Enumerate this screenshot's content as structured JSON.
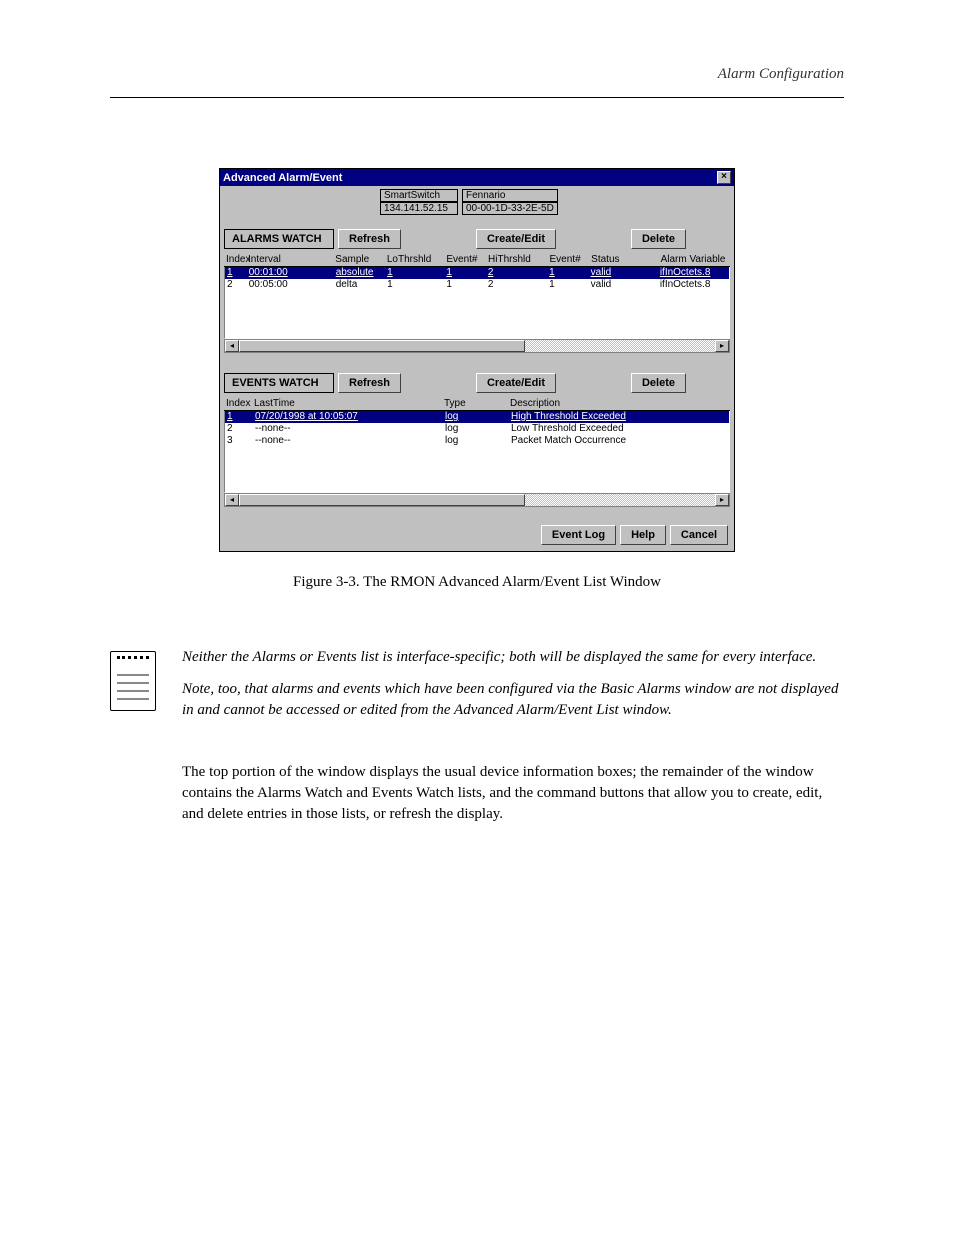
{
  "header": {
    "right": "Alarm Configuration"
  },
  "window": {
    "title": "Advanced Alarm/Event",
    "info": {
      "dev_name": "SmartSwitch",
      "dev_ip": "134.141.52.15",
      "loc_name": "Fennario",
      "mac": "00-00-1D-33-2E-5D"
    }
  },
  "alarms": {
    "label": "ALARMS WATCH",
    "buttons": {
      "refresh": "Refresh",
      "create": "Create/Edit",
      "delete": "Delete"
    },
    "cols": {
      "index": "Index",
      "interval": "Interval",
      "sample": "Sample",
      "lot": "LoThrshld",
      "ev1": "Event#",
      "hit": "HiThrshld",
      "ev2": "Event#",
      "status": "Status",
      "var": "Alarm Variable"
    },
    "rows": [
      {
        "idx": "1",
        "interval": "00:01:00",
        "sample": "absolute",
        "lot": "1",
        "ev1": "1",
        "hit": "2",
        "ev2": "1",
        "status": "valid",
        "var": "ifInOctets.8"
      },
      {
        "idx": "2",
        "interval": "00:05:00",
        "sample": "delta",
        "lot": "1",
        "ev1": "1",
        "hit": "2",
        "ev2": "1",
        "status": "valid",
        "var": "ifInOctets.8"
      }
    ]
  },
  "events": {
    "label": "EVENTS WATCH",
    "buttons": {
      "refresh": "Refresh",
      "create": "Create/Edit",
      "delete": "Delete"
    },
    "cols": {
      "index": "Index",
      "last": "LastTime",
      "type": "Type",
      "desc": "Description"
    },
    "rows": [
      {
        "idx": "1",
        "last": "07/20/1998 at 10:05:07",
        "type": "log",
        "desc": "High Threshold Exceeded"
      },
      {
        "idx": "2",
        "last": "--none--",
        "type": "log",
        "desc": "Low Threshold Exceeded"
      },
      {
        "idx": "3",
        "last": "--none--",
        "type": "log",
        "desc": "Packet Match Occurrence"
      }
    ]
  },
  "bottom": {
    "eventlog": "Event Log",
    "help": "Help",
    "cancel": "Cancel"
  },
  "caption": "Figure 3-3. The RMON Advanced Alarm/Event List Window",
  "note": {
    "p1": "Neither the Alarms or Events list is interface-specific; both will be displayed the same for every interface.",
    "p2": "Note, too, that alarms and events which have been configured via the Basic Alarms window are not displayed in and cannot be accessed or edited from the Advanced Alarm/Event List window."
  },
  "body": "The top portion of the window displays the usual device information boxes; the remainder of the window contains the Alarms Watch and Events Watch lists, and the command buttons that allow you to create, edit, and delete entries in those lists, or refresh the display."
}
